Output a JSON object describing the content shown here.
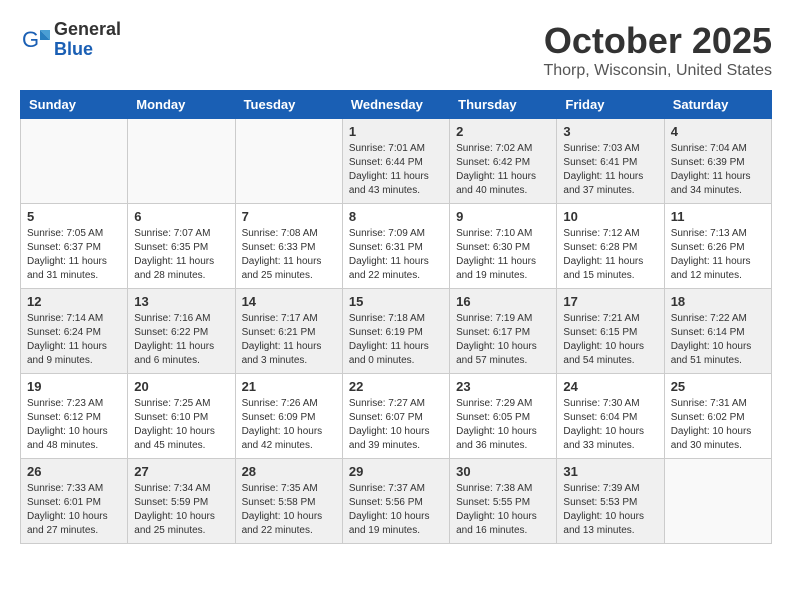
{
  "header": {
    "logo_general": "General",
    "logo_blue": "Blue",
    "month_title": "October 2025",
    "location": "Thorp, Wisconsin, United States"
  },
  "days_of_week": [
    "Sunday",
    "Monday",
    "Tuesday",
    "Wednesday",
    "Thursday",
    "Friday",
    "Saturday"
  ],
  "weeks": [
    [
      {
        "day": "",
        "info": ""
      },
      {
        "day": "",
        "info": ""
      },
      {
        "day": "",
        "info": ""
      },
      {
        "day": "1",
        "info": "Sunrise: 7:01 AM\nSunset: 6:44 PM\nDaylight: 11 hours\nand 43 minutes."
      },
      {
        "day": "2",
        "info": "Sunrise: 7:02 AM\nSunset: 6:42 PM\nDaylight: 11 hours\nand 40 minutes."
      },
      {
        "day": "3",
        "info": "Sunrise: 7:03 AM\nSunset: 6:41 PM\nDaylight: 11 hours\nand 37 minutes."
      },
      {
        "day": "4",
        "info": "Sunrise: 7:04 AM\nSunset: 6:39 PM\nDaylight: 11 hours\nand 34 minutes."
      }
    ],
    [
      {
        "day": "5",
        "info": "Sunrise: 7:05 AM\nSunset: 6:37 PM\nDaylight: 11 hours\nand 31 minutes."
      },
      {
        "day": "6",
        "info": "Sunrise: 7:07 AM\nSunset: 6:35 PM\nDaylight: 11 hours\nand 28 minutes."
      },
      {
        "day": "7",
        "info": "Sunrise: 7:08 AM\nSunset: 6:33 PM\nDaylight: 11 hours\nand 25 minutes."
      },
      {
        "day": "8",
        "info": "Sunrise: 7:09 AM\nSunset: 6:31 PM\nDaylight: 11 hours\nand 22 minutes."
      },
      {
        "day": "9",
        "info": "Sunrise: 7:10 AM\nSunset: 6:30 PM\nDaylight: 11 hours\nand 19 minutes."
      },
      {
        "day": "10",
        "info": "Sunrise: 7:12 AM\nSunset: 6:28 PM\nDaylight: 11 hours\nand 15 minutes."
      },
      {
        "day": "11",
        "info": "Sunrise: 7:13 AM\nSunset: 6:26 PM\nDaylight: 11 hours\nand 12 minutes."
      }
    ],
    [
      {
        "day": "12",
        "info": "Sunrise: 7:14 AM\nSunset: 6:24 PM\nDaylight: 11 hours\nand 9 minutes."
      },
      {
        "day": "13",
        "info": "Sunrise: 7:16 AM\nSunset: 6:22 PM\nDaylight: 11 hours\nand 6 minutes."
      },
      {
        "day": "14",
        "info": "Sunrise: 7:17 AM\nSunset: 6:21 PM\nDaylight: 11 hours\nand 3 minutes."
      },
      {
        "day": "15",
        "info": "Sunrise: 7:18 AM\nSunset: 6:19 PM\nDaylight: 11 hours\nand 0 minutes."
      },
      {
        "day": "16",
        "info": "Sunrise: 7:19 AM\nSunset: 6:17 PM\nDaylight: 10 hours\nand 57 minutes."
      },
      {
        "day": "17",
        "info": "Sunrise: 7:21 AM\nSunset: 6:15 PM\nDaylight: 10 hours\nand 54 minutes."
      },
      {
        "day": "18",
        "info": "Sunrise: 7:22 AM\nSunset: 6:14 PM\nDaylight: 10 hours\nand 51 minutes."
      }
    ],
    [
      {
        "day": "19",
        "info": "Sunrise: 7:23 AM\nSunset: 6:12 PM\nDaylight: 10 hours\nand 48 minutes."
      },
      {
        "day": "20",
        "info": "Sunrise: 7:25 AM\nSunset: 6:10 PM\nDaylight: 10 hours\nand 45 minutes."
      },
      {
        "day": "21",
        "info": "Sunrise: 7:26 AM\nSunset: 6:09 PM\nDaylight: 10 hours\nand 42 minutes."
      },
      {
        "day": "22",
        "info": "Sunrise: 7:27 AM\nSunset: 6:07 PM\nDaylight: 10 hours\nand 39 minutes."
      },
      {
        "day": "23",
        "info": "Sunrise: 7:29 AM\nSunset: 6:05 PM\nDaylight: 10 hours\nand 36 minutes."
      },
      {
        "day": "24",
        "info": "Sunrise: 7:30 AM\nSunset: 6:04 PM\nDaylight: 10 hours\nand 33 minutes."
      },
      {
        "day": "25",
        "info": "Sunrise: 7:31 AM\nSunset: 6:02 PM\nDaylight: 10 hours\nand 30 minutes."
      }
    ],
    [
      {
        "day": "26",
        "info": "Sunrise: 7:33 AM\nSunset: 6:01 PM\nDaylight: 10 hours\nand 27 minutes."
      },
      {
        "day": "27",
        "info": "Sunrise: 7:34 AM\nSunset: 5:59 PM\nDaylight: 10 hours\nand 25 minutes."
      },
      {
        "day": "28",
        "info": "Sunrise: 7:35 AM\nSunset: 5:58 PM\nDaylight: 10 hours\nand 22 minutes."
      },
      {
        "day": "29",
        "info": "Sunrise: 7:37 AM\nSunset: 5:56 PM\nDaylight: 10 hours\nand 19 minutes."
      },
      {
        "day": "30",
        "info": "Sunrise: 7:38 AM\nSunset: 5:55 PM\nDaylight: 10 hours\nand 16 minutes."
      },
      {
        "day": "31",
        "info": "Sunrise: 7:39 AM\nSunset: 5:53 PM\nDaylight: 10 hours\nand 13 minutes."
      },
      {
        "day": "",
        "info": ""
      }
    ]
  ]
}
